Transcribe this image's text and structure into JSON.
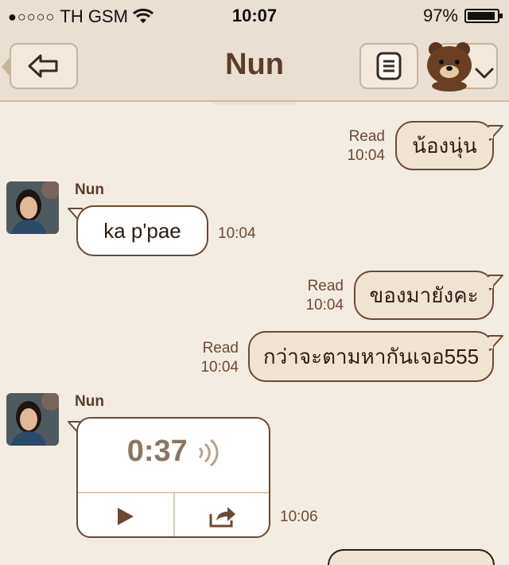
{
  "status": {
    "signal": "●○○○○",
    "carrier": "TH GSM",
    "time": "10:07",
    "battery": "97%"
  },
  "header": {
    "title": "Nun"
  },
  "messages": [
    {
      "direction": "out",
      "text": "น้องนุ่น",
      "read": "Read",
      "time": "10:04"
    },
    {
      "direction": "in",
      "sender": "Nun",
      "text": "ka p'pae",
      "time": "10:04"
    },
    {
      "direction": "out",
      "text": "ของมายังคะ",
      "read": "Read",
      "time": "10:04"
    },
    {
      "direction": "out",
      "text": "กว่าจะตามหากันเจอ555",
      "read": "Read",
      "time": "10:04"
    },
    {
      "direction": "in",
      "sender": "Nun",
      "type": "voice",
      "duration": "0:37",
      "time": "10:06"
    }
  ],
  "colors": {
    "accent_brown": "#6b4a35",
    "nav_bg": "#e9dfd2",
    "chat_bg": "#f3ece2"
  },
  "icons": {
    "back": "back-arrow-icon",
    "menu": "list-menu-icon",
    "sticker": "brown-bear-icon",
    "play": "play-icon",
    "share": "share-icon"
  }
}
